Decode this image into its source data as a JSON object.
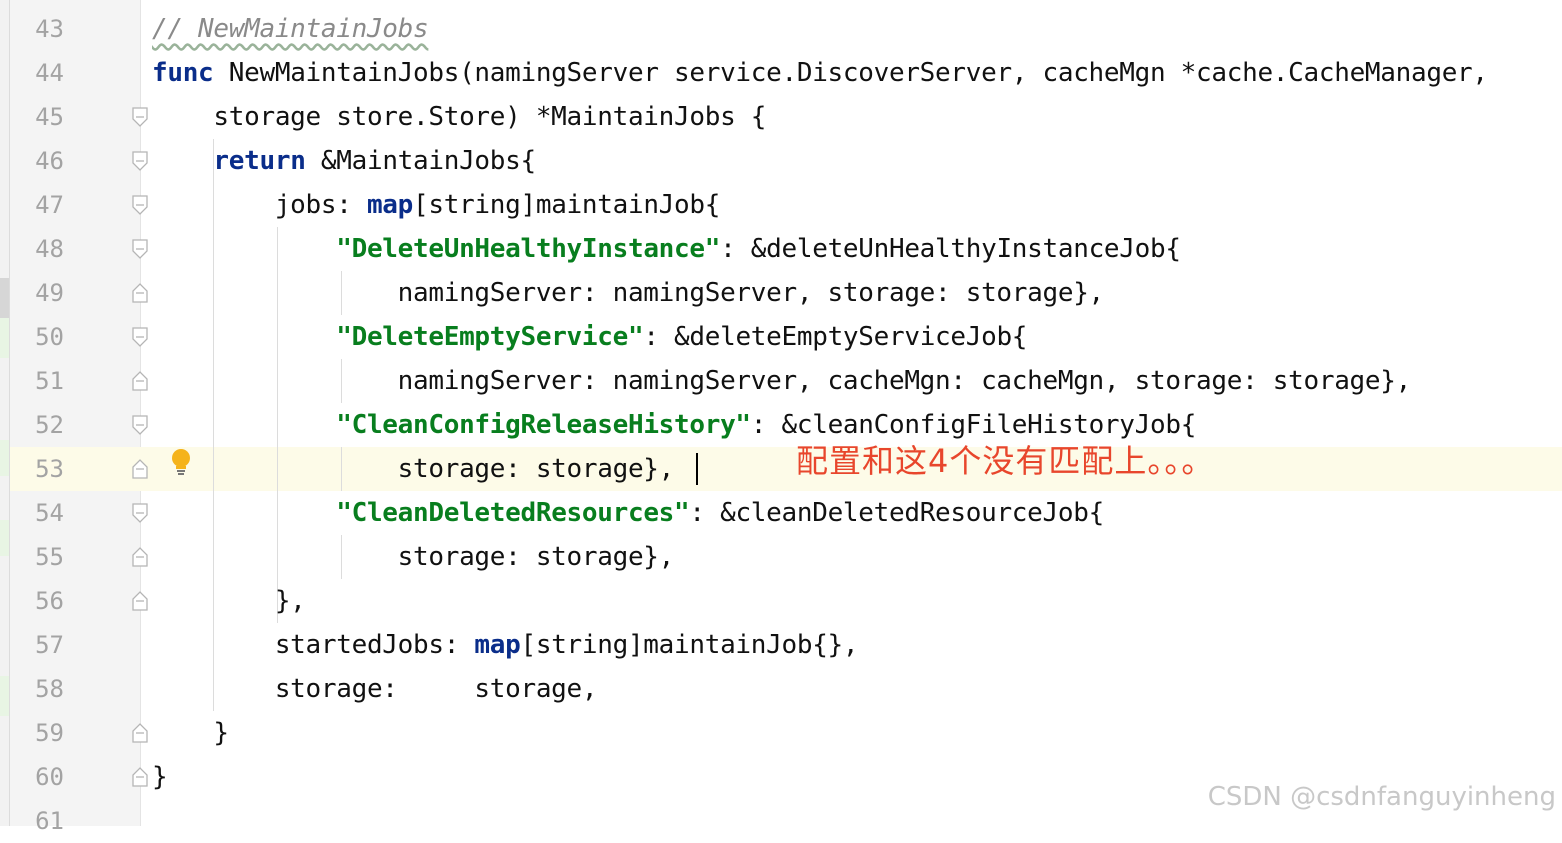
{
  "editor": {
    "lines": [
      {
        "number": "43",
        "tokens": [
          {
            "text": "// NewMaintainJobs",
            "type": "comment"
          }
        ]
      },
      {
        "number": "44",
        "tokens": [
          {
            "text": "func",
            "type": "keyword"
          },
          {
            "text": " NewMaintainJobs(namingServer service.DiscoverServer, cacheMgn *cache.CacheManager,",
            "type": "plain"
          }
        ]
      },
      {
        "number": "45",
        "tokens": [
          {
            "text": "    storage store.Store) *MaintainJobs {",
            "type": "plain"
          }
        ]
      },
      {
        "number": "46",
        "tokens": [
          {
            "text": "    ",
            "type": "plain"
          },
          {
            "text": "return",
            "type": "keyword"
          },
          {
            "text": " &MaintainJobs{",
            "type": "plain"
          }
        ]
      },
      {
        "number": "47",
        "tokens": [
          {
            "text": "        jobs: ",
            "type": "plain"
          },
          {
            "text": "map",
            "type": "keyword"
          },
          {
            "text": "[string]maintainJob{",
            "type": "plain"
          }
        ]
      },
      {
        "number": "48",
        "tokens": [
          {
            "text": "            ",
            "type": "plain"
          },
          {
            "text": "\"DeleteUnHealthyInstance\"",
            "type": "string"
          },
          {
            "text": ": &deleteUnHealthyInstanceJob{",
            "type": "plain"
          }
        ]
      },
      {
        "number": "49",
        "tokens": [
          {
            "text": "                namingServer: namingServer, storage: storage},",
            "type": "plain"
          }
        ]
      },
      {
        "number": "50",
        "tokens": [
          {
            "text": "            ",
            "type": "plain"
          },
          {
            "text": "\"DeleteEmptyService\"",
            "type": "string"
          },
          {
            "text": ": &deleteEmptyServiceJob{",
            "type": "plain"
          }
        ]
      },
      {
        "number": "51",
        "tokens": [
          {
            "text": "                namingServer: namingServer, cacheMgn: cacheMgn, storage: storage},",
            "type": "plain"
          }
        ]
      },
      {
        "number": "52",
        "tokens": [
          {
            "text": "            ",
            "type": "plain"
          },
          {
            "text": "\"CleanConfigReleaseHistory\"",
            "type": "string"
          },
          {
            "text": ": &cleanConfigFileHistoryJob{",
            "type": "plain"
          }
        ]
      },
      {
        "number": "53",
        "tokens": [
          {
            "text": "                storage: storage},",
            "type": "plain"
          }
        ]
      },
      {
        "number": "54",
        "tokens": [
          {
            "text": "            ",
            "type": "plain"
          },
          {
            "text": "\"CleanDeletedResources\"",
            "type": "string"
          },
          {
            "text": ": &cleanDeletedResourceJob{",
            "type": "plain"
          }
        ]
      },
      {
        "number": "55",
        "tokens": [
          {
            "text": "                storage: storage},",
            "type": "plain"
          }
        ]
      },
      {
        "number": "56",
        "tokens": [
          {
            "text": "        },",
            "type": "plain"
          }
        ]
      },
      {
        "number": "57",
        "tokens": [
          {
            "text": "        startedJobs: ",
            "type": "plain"
          },
          {
            "text": "map",
            "type": "keyword"
          },
          {
            "text": "[string]maintainJob{},",
            "type": "plain"
          }
        ]
      },
      {
        "number": "58",
        "tokens": [
          {
            "text": "        storage:     storage,",
            "type": "plain"
          }
        ]
      },
      {
        "number": "59",
        "tokens": [
          {
            "text": "    }",
            "type": "plain"
          }
        ]
      },
      {
        "number": "60",
        "tokens": [
          {
            "text": "}",
            "type": "plain"
          }
        ]
      },
      {
        "number": "61",
        "tokens": []
      }
    ],
    "current_line": "53",
    "fold_markers": [
      {
        "line": "45",
        "kind": "open"
      },
      {
        "line": "46",
        "kind": "open"
      },
      {
        "line": "47",
        "kind": "open"
      },
      {
        "line": "48",
        "kind": "open"
      },
      {
        "line": "49",
        "kind": "close"
      },
      {
        "line": "50",
        "kind": "open"
      },
      {
        "line": "51",
        "kind": "close"
      },
      {
        "line": "52",
        "kind": "open"
      },
      {
        "line": "53",
        "kind": "close"
      },
      {
        "line": "54",
        "kind": "open"
      },
      {
        "line": "55",
        "kind": "close"
      },
      {
        "line": "56",
        "kind": "close"
      },
      {
        "line": "59",
        "kind": "close"
      },
      {
        "line": "60",
        "kind": "close"
      }
    ],
    "intention_icon": "lightbulb-icon"
  },
  "annotation": {
    "text": "配置和这4个没有匹配上。。。",
    "color": "#e8462c"
  },
  "watermark": {
    "text": "CSDN @csdnfanguyinheng"
  },
  "colors": {
    "keyword": "#0a2d8a",
    "string": "#087e1e",
    "comment": "#8a8a8a",
    "current_line_bg": "#fdfbe8",
    "line_number": "#a3a3a3"
  }
}
